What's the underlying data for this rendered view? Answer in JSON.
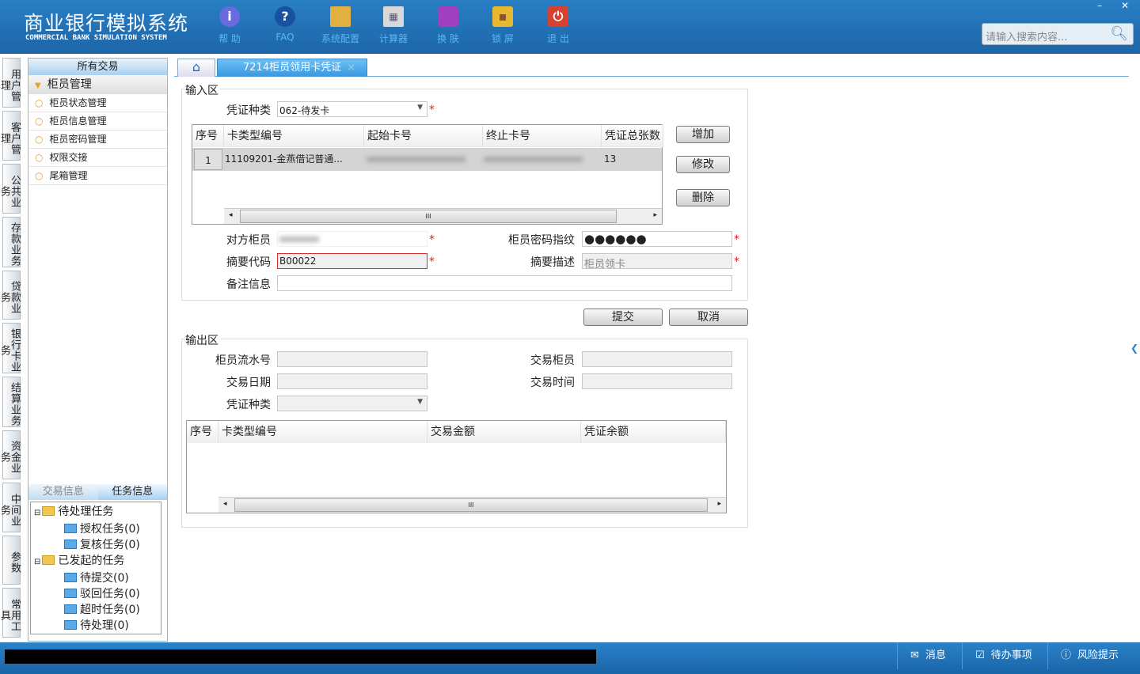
{
  "header": {
    "title_cn": "商业银行模拟系统",
    "title_en": "COMMERCIAL BANK SIMULATION SYSTEM",
    "tools": [
      {
        "label": "帮 助",
        "icon": "info-icon"
      },
      {
        "label": "FAQ",
        "icon": "question-icon"
      },
      {
        "label": "系统配置",
        "icon": "toolbox-icon"
      },
      {
        "label": "计算器",
        "icon": "calculator-icon"
      },
      {
        "label": "换 肤",
        "icon": "shirt-icon"
      },
      {
        "label": "锁 屏",
        "icon": "lock-icon"
      },
      {
        "label": "退 出",
        "icon": "power-icon"
      }
    ],
    "search_placeholder": "请输入搜索内容...",
    "minimize": "–",
    "close": "✕"
  },
  "vtabs": [
    "用户管理",
    "客户管理",
    "公共业务",
    "存款业务",
    "贷款业务",
    "银行卡业务",
    "结算业务",
    "资金业务",
    "中间业务",
    "参数",
    "常用工具"
  ],
  "sidebar": {
    "header": "所有交易",
    "group": "柜员管理",
    "items": [
      "柜员状态管理",
      "柜员信息管理",
      "柜员密码管理",
      "权限交接",
      "尾箱管理"
    ],
    "bottom_tabs": [
      "交易信息",
      "任务信息"
    ],
    "tree": [
      {
        "label": "待处理任务",
        "children": [
          "授权任务(0)",
          "复核任务(0)"
        ]
      },
      {
        "label": "已发起的任务",
        "children": [
          "待提交(0)",
          "驳回任务(0)",
          "超时任务(0)",
          "待处理(0)"
        ]
      }
    ]
  },
  "tabs": {
    "active": "7214柜员领用卡凭证",
    "close": "×"
  },
  "input": {
    "title": "输入区",
    "voucher_type_label": "凭证种类",
    "voucher_type": "062-待发卡",
    "columns": [
      "序号",
      "卡类型编号",
      "起始卡号",
      "终止卡号",
      "凭证总张数"
    ],
    "rows": [
      {
        "no": "1",
        "card_type": "11109201-金燕借记普通...",
        "start": "",
        "end": "",
        "total": "13"
      }
    ],
    "add": "增加",
    "edit": "修改",
    "delete": "删除",
    "counter_teller_label": "对方柜员",
    "password_label": "柜员密码指纹",
    "password_value": "●●●●●●",
    "summary_code_label": "摘要代码",
    "summary_code": "B00022",
    "summary_desc_label": "摘要描述",
    "summary_desc": "柜员领卡",
    "remark_label": "备注信息",
    "required": "*"
  },
  "actions": {
    "submit": "提交",
    "cancel": "取消"
  },
  "output": {
    "title": "输出区",
    "serial_label": "柜员流水号",
    "teller_label": "交易柜员",
    "date_label": "交易日期",
    "time_label": "交易时间",
    "voucher_type_label": "凭证种类",
    "columns": [
      "序号",
      "卡类型编号",
      "交易金额",
      "凭证余额"
    ]
  },
  "scroll": {
    "left": "◂",
    "right": "▸",
    "grip": "III"
  },
  "statusbar": {
    "message": "消息",
    "todo": "待办事项",
    "risk": "风险提示"
  }
}
